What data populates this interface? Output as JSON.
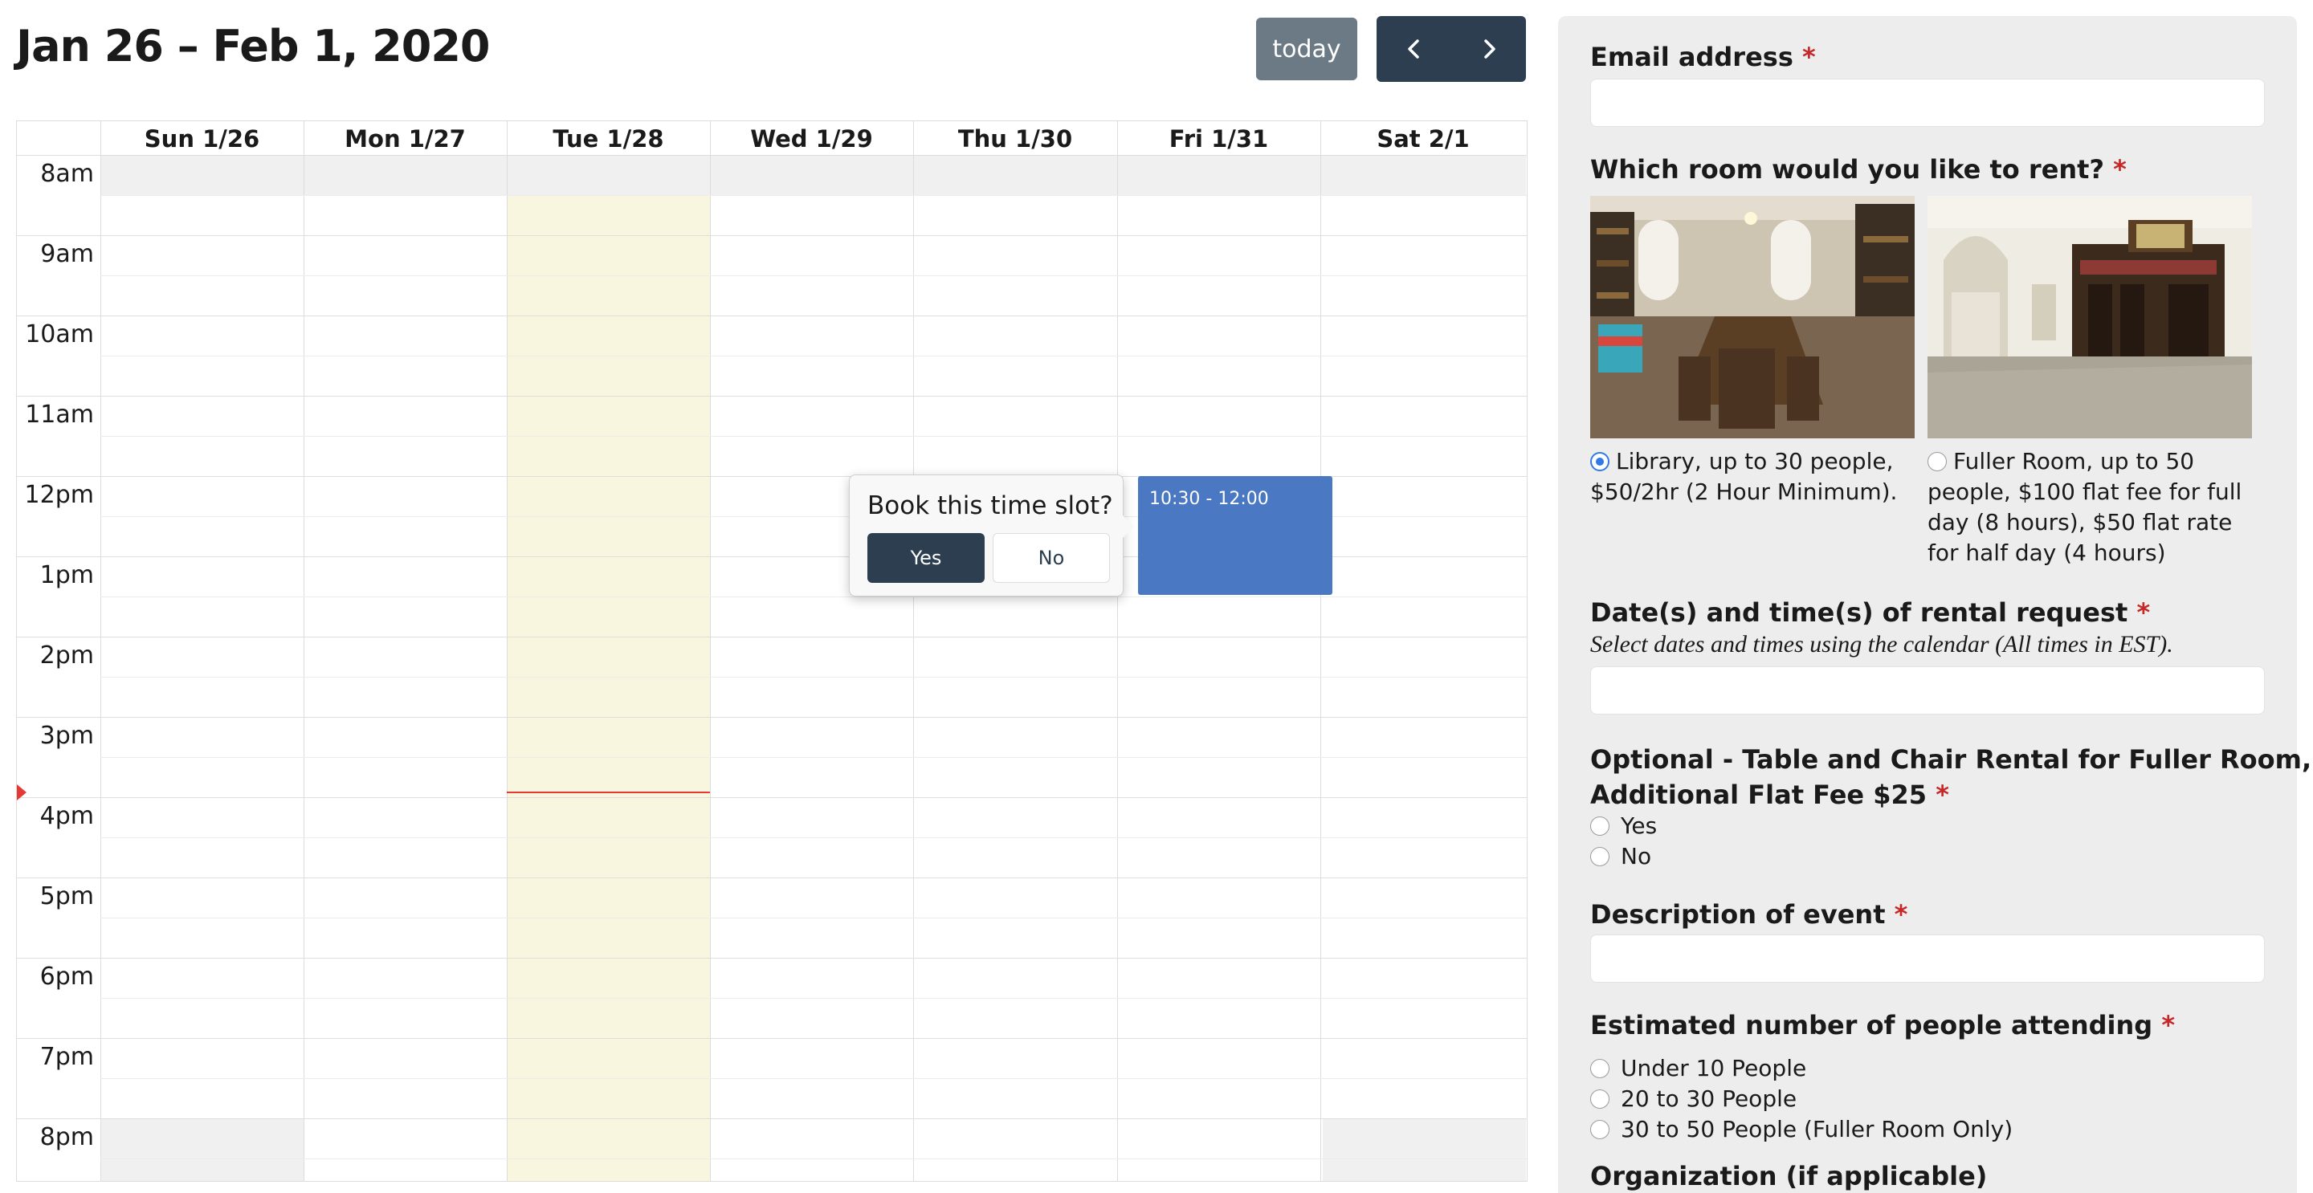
{
  "calendar": {
    "title": "Jan 26 – Feb 1, 2020",
    "today_label": "today",
    "prev_icon": "chevron-left-icon",
    "next_icon": "chevron-right-icon",
    "days": [
      "Sun 1/26",
      "Mon 1/27",
      "Tue 1/28",
      "Wed 1/29",
      "Thu 1/30",
      "Fri 1/31",
      "Sat 2/1"
    ],
    "today_day": "Tue 1/28",
    "hours": [
      "8am",
      "9am",
      "10am",
      "11am",
      "12pm",
      "1pm",
      "2pm",
      "3pm",
      "4pm",
      "5pm",
      "6pm",
      "7pm",
      "8pm"
    ],
    "now_time": "3:55pm",
    "event": {
      "day": "Fri 1/31",
      "label": "10:30 - 12:00",
      "color": "#4a78c2"
    },
    "popover": {
      "question": "Book this time slot?",
      "yes": "Yes",
      "no": "No"
    }
  },
  "form": {
    "required_mark": "*",
    "email": {
      "label": "Email address",
      "value": ""
    },
    "room": {
      "label": "Which room would you like to rent?",
      "options": [
        {
          "text": "Library, up to 30 people, $50/2hr (2 Hour Minimum).",
          "checked": true,
          "image": "library-photo"
        },
        {
          "text": "Fuller Room, up to 50 people, $100 flat fee for full day (8 hours), $50 flat rate for half day (4 hours)",
          "checked": false,
          "image": "fuller-room-photo"
        }
      ]
    },
    "dates": {
      "label": "Date(s) and time(s) of rental request",
      "hint": "Select dates and times using the calendar (All times in EST).",
      "value": ""
    },
    "tables": {
      "label_line1": "Optional - Table and Chair Rental for Fuller Room,",
      "label_line2": "Additional Flat Fee $25",
      "options": [
        "Yes",
        "No"
      ]
    },
    "description": {
      "label": "Description of event",
      "value": ""
    },
    "attendance": {
      "label": "Estimated number of people attending",
      "options": [
        "Under 10 People",
        "20 to 30 People",
        "30 to 50 People (Fuller Room Only)"
      ]
    },
    "organization": {
      "label": "Organization (if applicable)"
    }
  },
  "colors": {
    "accent": "#2c3e50",
    "today_bg": "#f9f6e0",
    "now_line": "#e53935",
    "required": "#c62828"
  }
}
